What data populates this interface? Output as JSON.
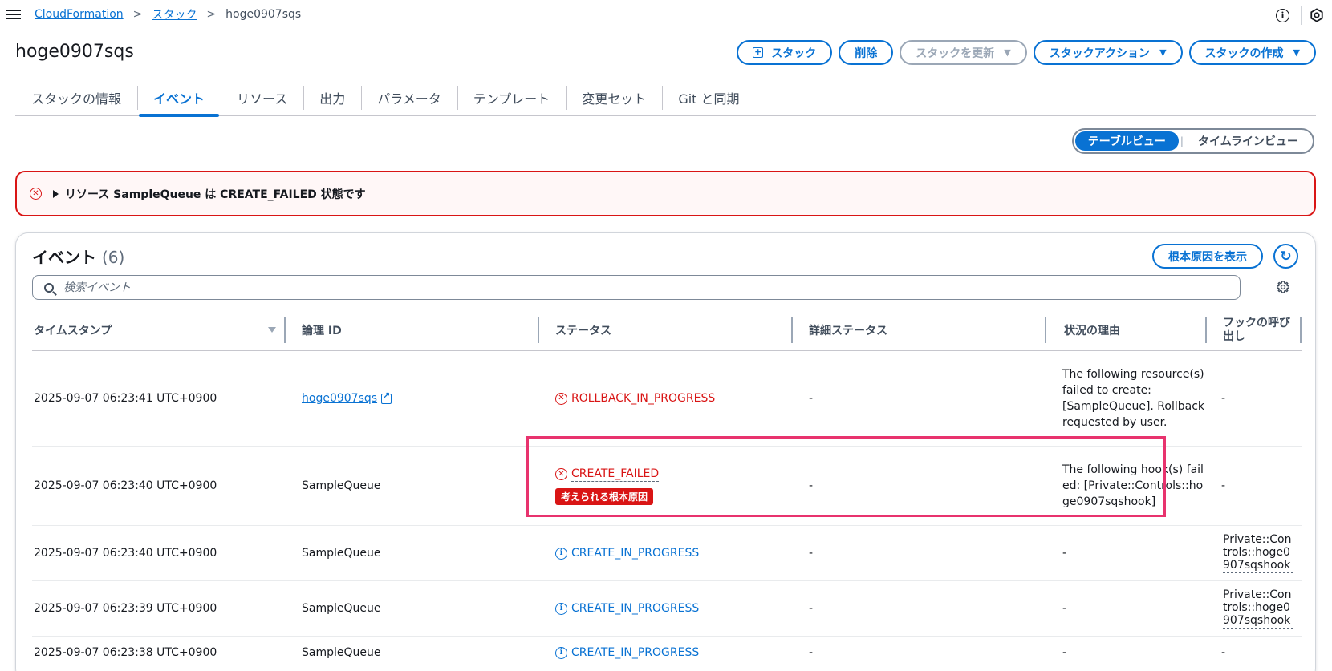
{
  "breadcrumb": {
    "items": [
      "CloudFormation",
      "スタック"
    ],
    "current": "hoge0907sqs"
  },
  "header": {
    "title": "hoge0907sqs",
    "actions": {
      "stack": "スタック",
      "delete": "削除",
      "update": "スタックを更新",
      "stack_actions": "スタックアクション",
      "create_stack": "スタックの作成"
    }
  },
  "tabs": [
    {
      "label": "スタックの情報"
    },
    {
      "label": "イベント"
    },
    {
      "label": "リソース"
    },
    {
      "label": "出力"
    },
    {
      "label": "パラメータ"
    },
    {
      "label": "テンプレート"
    },
    {
      "label": "変更セット"
    },
    {
      "label": "Git と同期"
    }
  ],
  "view_toggle": {
    "table": "テーブルビュー",
    "timeline": "タイムラインビュー"
  },
  "alert": {
    "text": "リソース SampleQueue は CREATE_FAILED 状態です"
  },
  "events": {
    "title": "イベント",
    "count": "(6)",
    "root_cause_button": "根本原因を表示",
    "search_placeholder": "検索イベント",
    "columns": [
      "タイムスタンプ",
      "論理 ID",
      "ステータス",
      "詳細ステータス",
      "状況の理由",
      "フックの呼び出し"
    ],
    "rows": [
      {
        "timestamp": "2025-09-07 06:23:41 UTC+0900",
        "logical_id": "hoge0907sqs",
        "status": "ROLLBACK_IN_PROGRESS",
        "detail_status": "-",
        "reason": "The following resource(s) failed to create: [SampleQueue]. Rollback requested by user.",
        "hook": "-"
      },
      {
        "timestamp": "2025-09-07 06:23:40 UTC+0900",
        "logical_id": "SampleQueue",
        "status": "CREATE_FAILED",
        "badge": "考えられる根本原因",
        "detail_status": "-",
        "reason": "The following hook(s) failed: [Private::Controls::hoge0907sqshook]",
        "hook": "-"
      },
      {
        "timestamp": "2025-09-07 06:23:40 UTC+0900",
        "logical_id": "SampleQueue",
        "status": "CREATE_IN_PROGRESS",
        "detail_status": "-",
        "reason": "-",
        "hook": "Private::Controls::hoge0907sqshook"
      },
      {
        "timestamp": "2025-09-07 06:23:39 UTC+0900",
        "logical_id": "SampleQueue",
        "status": "CREATE_IN_PROGRESS",
        "detail_status": "-",
        "reason": "-",
        "hook": "Private::Controls::hoge0907sqshook"
      },
      {
        "timestamp": "2025-09-07 06:23:38 UTC+0900",
        "logical_id": "SampleQueue",
        "status": "CREATE_IN_PROGRESS",
        "detail_status": "-",
        "reason": "-",
        "hook": "-"
      }
    ]
  },
  "colors": {
    "accent": "#0972d3",
    "error": "#d91515",
    "highlight": "#e8336e"
  }
}
